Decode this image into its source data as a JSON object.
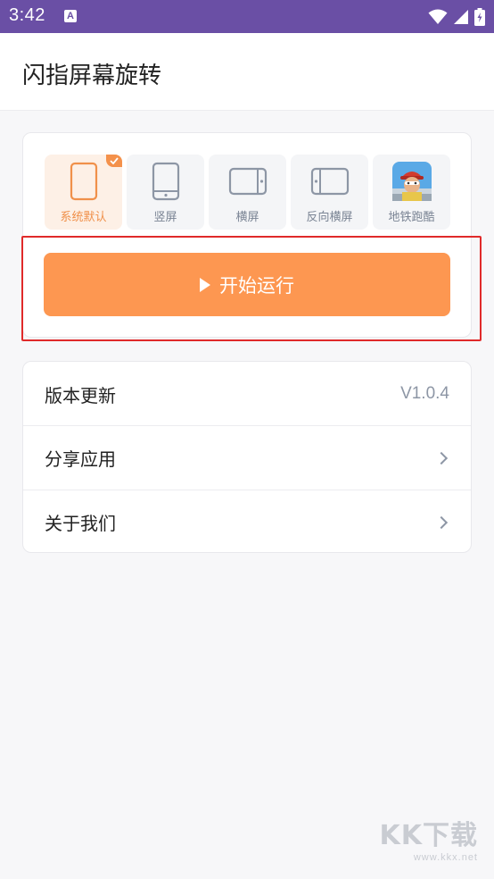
{
  "status_bar": {
    "time": "3:42",
    "notification_letter": "A"
  },
  "app": {
    "title": "闪指屏幕旋转"
  },
  "modes": [
    {
      "label": "系统默认",
      "icon": "phone-outline-icon",
      "selected": true
    },
    {
      "label": "竖屏",
      "icon": "portrait-icon",
      "selected": false
    },
    {
      "label": "横屏",
      "icon": "landscape-icon",
      "selected": false
    },
    {
      "label": "反向横屏",
      "icon": "reverse-landscape-icon",
      "selected": false
    },
    {
      "label": "地铁跑酷",
      "icon": "subway-surfers-app-icon",
      "selected": false
    }
  ],
  "start_button": {
    "label": "开始运行"
  },
  "menu": {
    "version": {
      "label": "版本更新",
      "value": "V1.0.4"
    },
    "share": {
      "label": "分享应用"
    },
    "about": {
      "label": "关于我们"
    }
  },
  "watermark": {
    "big": "KK下载",
    "small": "www.kkx.net"
  },
  "colors": {
    "status_bar": "#6a4fa5",
    "accent": "#fd9751",
    "highlight_border": "#e02a2a"
  }
}
